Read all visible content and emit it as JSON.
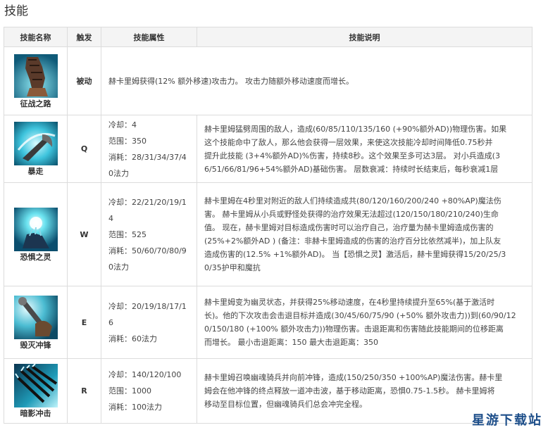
{
  "page_title": "技能",
  "header": {
    "name": "技能名称",
    "key": "触发",
    "attr": "技能属性",
    "desc": "技能说明"
  },
  "skills": [
    {
      "name": "征战之路",
      "key": "被动",
      "icon": "armored-arm-icon",
      "attrs": [],
      "desc": "赫卡里姆获得(12% 额外移速)攻击力。 攻击力随额外移动速度而增长。"
    },
    {
      "name": "暴走",
      "key": "Q",
      "icon": "blade-swing-icon",
      "attrs": [
        "冷却：4",
        "范围：350",
        "消耗：28/31/34/37/4",
        "0法力"
      ],
      "desc_lines": [
        "赫卡里姆猛劈周围的敌人，造成(60/85/110/135/160 (+90%额外AD))物理伤害。如果",
        "这个技能命中了敌人，那么他会获得一层效果，来使这次技能冷却时间降低0.75秒并",
        "提升此技能 (3+4%额外AD)%伤害，持续8秒。这个效果至多可达3层。 对小兵造成(3",
        "6/51/66/81/96+54%额外AD)基础伤害。 层数衰减：持续时长结束后，每秒衰减1层"
      ]
    },
    {
      "name": "恐惧之灵",
      "key": "W",
      "icon": "spirit-orb-icon",
      "attrs": [
        "冷却：22/21/20/19/1",
        "4",
        "范围：525",
        "消耗：50/60/70/80/9",
        "0法力"
      ],
      "desc_lines": [
        "赫卡里姆在4秒里对附近的敌人们持续造成共(80/120/160/200/240 +80%AP)魔法伤",
        "害。 赫卡里姆从小兵或野怪处获得的治疗效果无法超过(120/150/180/210/240)生命",
        "值。 现在，赫卡里姆对目标造成伤害时可以治疗自己，治疗量为赫卡里姆造成伤害的",
        "(25%+2%额外AD ) (备注：非赫卡里姆造成的伤害的治疗百分比依然减半)，加上队友",
        "造成伤害的(12.5% +1%额外AD)。 当【恐惧之灵】激活后，赫卡里姆获得15/20/25/3",
        "0/35护甲和魔抗"
      ]
    },
    {
      "name": "毁灭冲锋",
      "key": "E",
      "icon": "lance-charge-icon",
      "attrs": [
        "冷却：20/19/18/17/1",
        "6",
        "消耗：60法力"
      ],
      "desc_lines": [
        "赫卡里姆变为幽灵状态，并获得25%移动速度，在4秒里持续提升至65%(基于激活时",
        "长)。他的下次攻击会击退目标并造成(30/45/60/75/90 (+50% 额外攻击力))到(60/90/12",
        "0/150/180 (+100% 额外攻击力))物理伤害。击退距离和伤害随此技能期间的位移距离",
        "而增长。 最小击退距离：150 最大击退距离：350"
      ]
    },
    {
      "name": "暗影冲击",
      "key": "R",
      "icon": "shadow-riders-icon",
      "attrs": [
        "冷却：140/120/100",
        "范围：1000",
        "消耗：100法力"
      ],
      "desc_lines": [
        "赫卡里姆召唤幽魂骑兵并向前冲锋，造成(150/250/350 +100%AP)魔法伤害。赫卡里",
        "姆会在他冲锋的终点释放一道冲击波，基于移动距离，恐惧0.75-1.5秒。 赫卡里姆将",
        "移动至目标位置，但幽魂骑兵们总会冲完全程。"
      ]
    }
  ],
  "watermark": "星游下载站"
}
